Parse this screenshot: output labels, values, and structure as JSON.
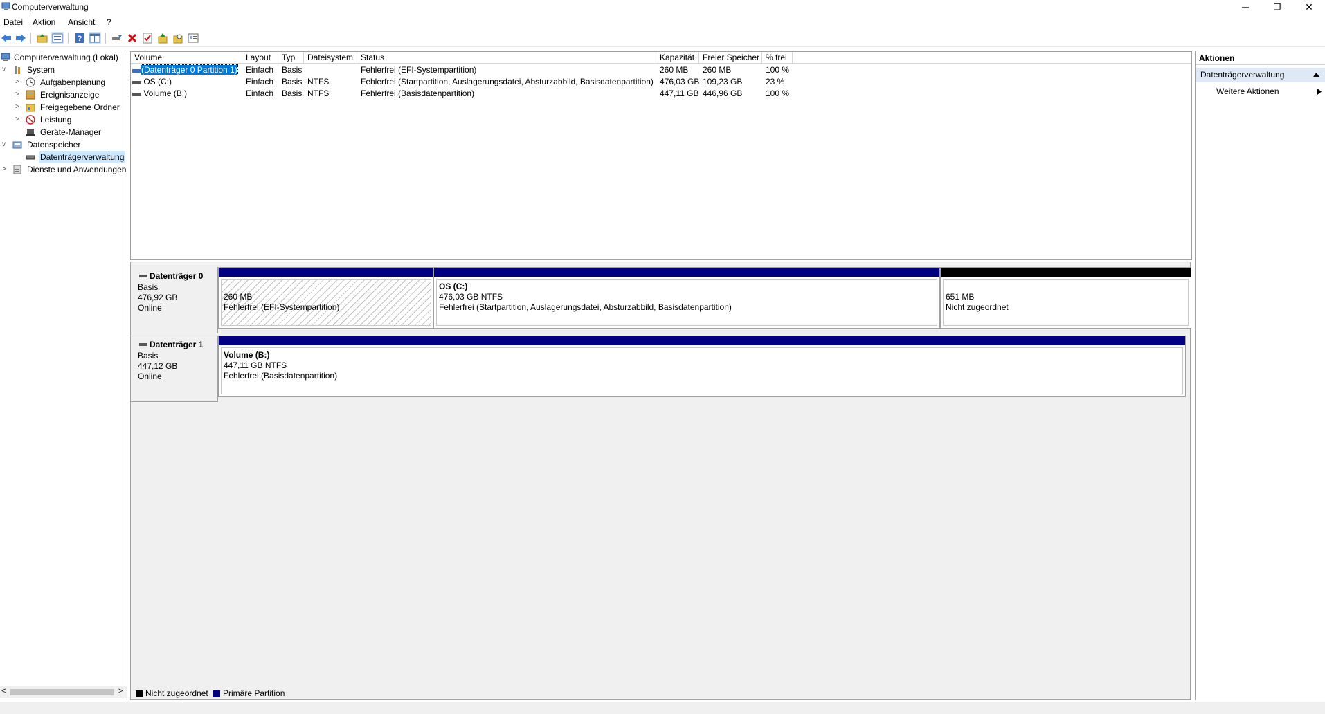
{
  "window": {
    "title": "Computerverwaltung",
    "minimize": "─",
    "restore": "❐",
    "close": "✕"
  },
  "menu": [
    "Datei",
    "Aktion",
    "Ansicht",
    "?"
  ],
  "toolbar": {
    "icons": [
      "back-arrow-icon",
      "forward-arrow-icon",
      "folder-up-icon",
      "properties-icon",
      "help-icon",
      "view-icon",
      "connect-icon",
      "delete-icon",
      "check-icon",
      "export-icon",
      "search-icon",
      "console-icon"
    ]
  },
  "tree": {
    "items": [
      {
        "label": "Computerverwaltung (Lokal)",
        "level": 0,
        "icon": "computer-icon",
        "expander": ""
      },
      {
        "label": "System",
        "level": 1,
        "icon": "tools-icon",
        "expander": "v"
      },
      {
        "label": "Aufgabenplanung",
        "level": 2,
        "icon": "clock-icon",
        "expander": ">"
      },
      {
        "label": "Ereignisanzeige",
        "level": 2,
        "icon": "event-icon",
        "expander": ">"
      },
      {
        "label": "Freigegebene Ordner",
        "level": 2,
        "icon": "shared-folder-icon",
        "expander": ">"
      },
      {
        "label": "Leistung",
        "level": 2,
        "icon": "performance-icon",
        "expander": ">"
      },
      {
        "label": "Geräte-Manager",
        "level": 2,
        "icon": "device-manager-icon",
        "expander": ""
      },
      {
        "label": "Datenspeicher",
        "level": 1,
        "icon": "storage-icon",
        "expander": "v"
      },
      {
        "label": "Datenträgerverwaltung",
        "level": 2,
        "icon": "disk-icon",
        "expander": "",
        "selected": true
      },
      {
        "label": "Dienste und Anwendungen",
        "level": 1,
        "icon": "services-icon",
        "expander": ">"
      }
    ]
  },
  "volumes": {
    "columns": [
      "Volume",
      "Layout",
      "Typ",
      "Dateisystem",
      "Status",
      "Kapazität",
      "Freier Speicher",
      "% frei"
    ],
    "rows": [
      {
        "volume": "(Datenträger 0 Partition 1)",
        "layout": "Einfach",
        "typ": "Basis",
        "fs": "",
        "status": "Fehlerfrei (EFI-Systempartition)",
        "kapazitaet": "260 MB",
        "frei": "260 MB",
        "prozent": "100 %",
        "selected": true
      },
      {
        "volume": "OS (C:)",
        "layout": "Einfach",
        "typ": "Basis",
        "fs": "NTFS",
        "status": "Fehlerfrei (Startpartition, Auslagerungsdatei, Absturzabbild, Basisdatenpartition)",
        "kapazitaet": "476,03 GB",
        "frei": "109,23 GB",
        "prozent": "23 %"
      },
      {
        "volume": "Volume (B:)",
        "layout": "Einfach",
        "typ": "Basis",
        "fs": "NTFS",
        "status": "Fehlerfrei (Basisdatenpartition)",
        "kapazitaet": "447,11 GB",
        "frei": "446,96 GB",
        "prozent": "100 %"
      }
    ]
  },
  "disks": [
    {
      "name": "Datenträger 0",
      "type": "Basis",
      "size": "476,92 GB",
      "state": "Online",
      "partitions": [
        {
          "name": "",
          "size": "260 MB",
          "status": "Fehlerfrei (EFI-Systempartition)",
          "kind": "primary",
          "hatched": true
        },
        {
          "name": "OS  (C:)",
          "size": "476,03 GB NTFS",
          "status": "Fehlerfrei (Startpartition, Auslagerungsdatei, Absturzabbild, Basisdatenpartition)",
          "kind": "primary"
        },
        {
          "name": "",
          "size": "651 MB",
          "status": "Nicht zugeordnet",
          "kind": "unallocated"
        }
      ]
    },
    {
      "name": "Datenträger 1",
      "type": "Basis",
      "size": "447,12 GB",
      "state": "Online",
      "partitions": [
        {
          "name": "Volume  (B:)",
          "size": "447,11 GB NTFS",
          "status": "Fehlerfrei (Basisdatenpartition)",
          "kind": "primary"
        }
      ]
    }
  ],
  "legend": [
    {
      "label": "Nicht zugeordnet",
      "color": "#000000"
    },
    {
      "label": "Primäre Partition",
      "color": "#000080"
    }
  ],
  "actions": {
    "header": "Aktionen",
    "section": "Datenträgerverwaltung",
    "more": "Weitere Aktionen"
  },
  "colors": {
    "primary_partition": "#000080",
    "unallocated": "#000000",
    "selection": "#0078d7",
    "tree_selection": "#cce8ff"
  }
}
